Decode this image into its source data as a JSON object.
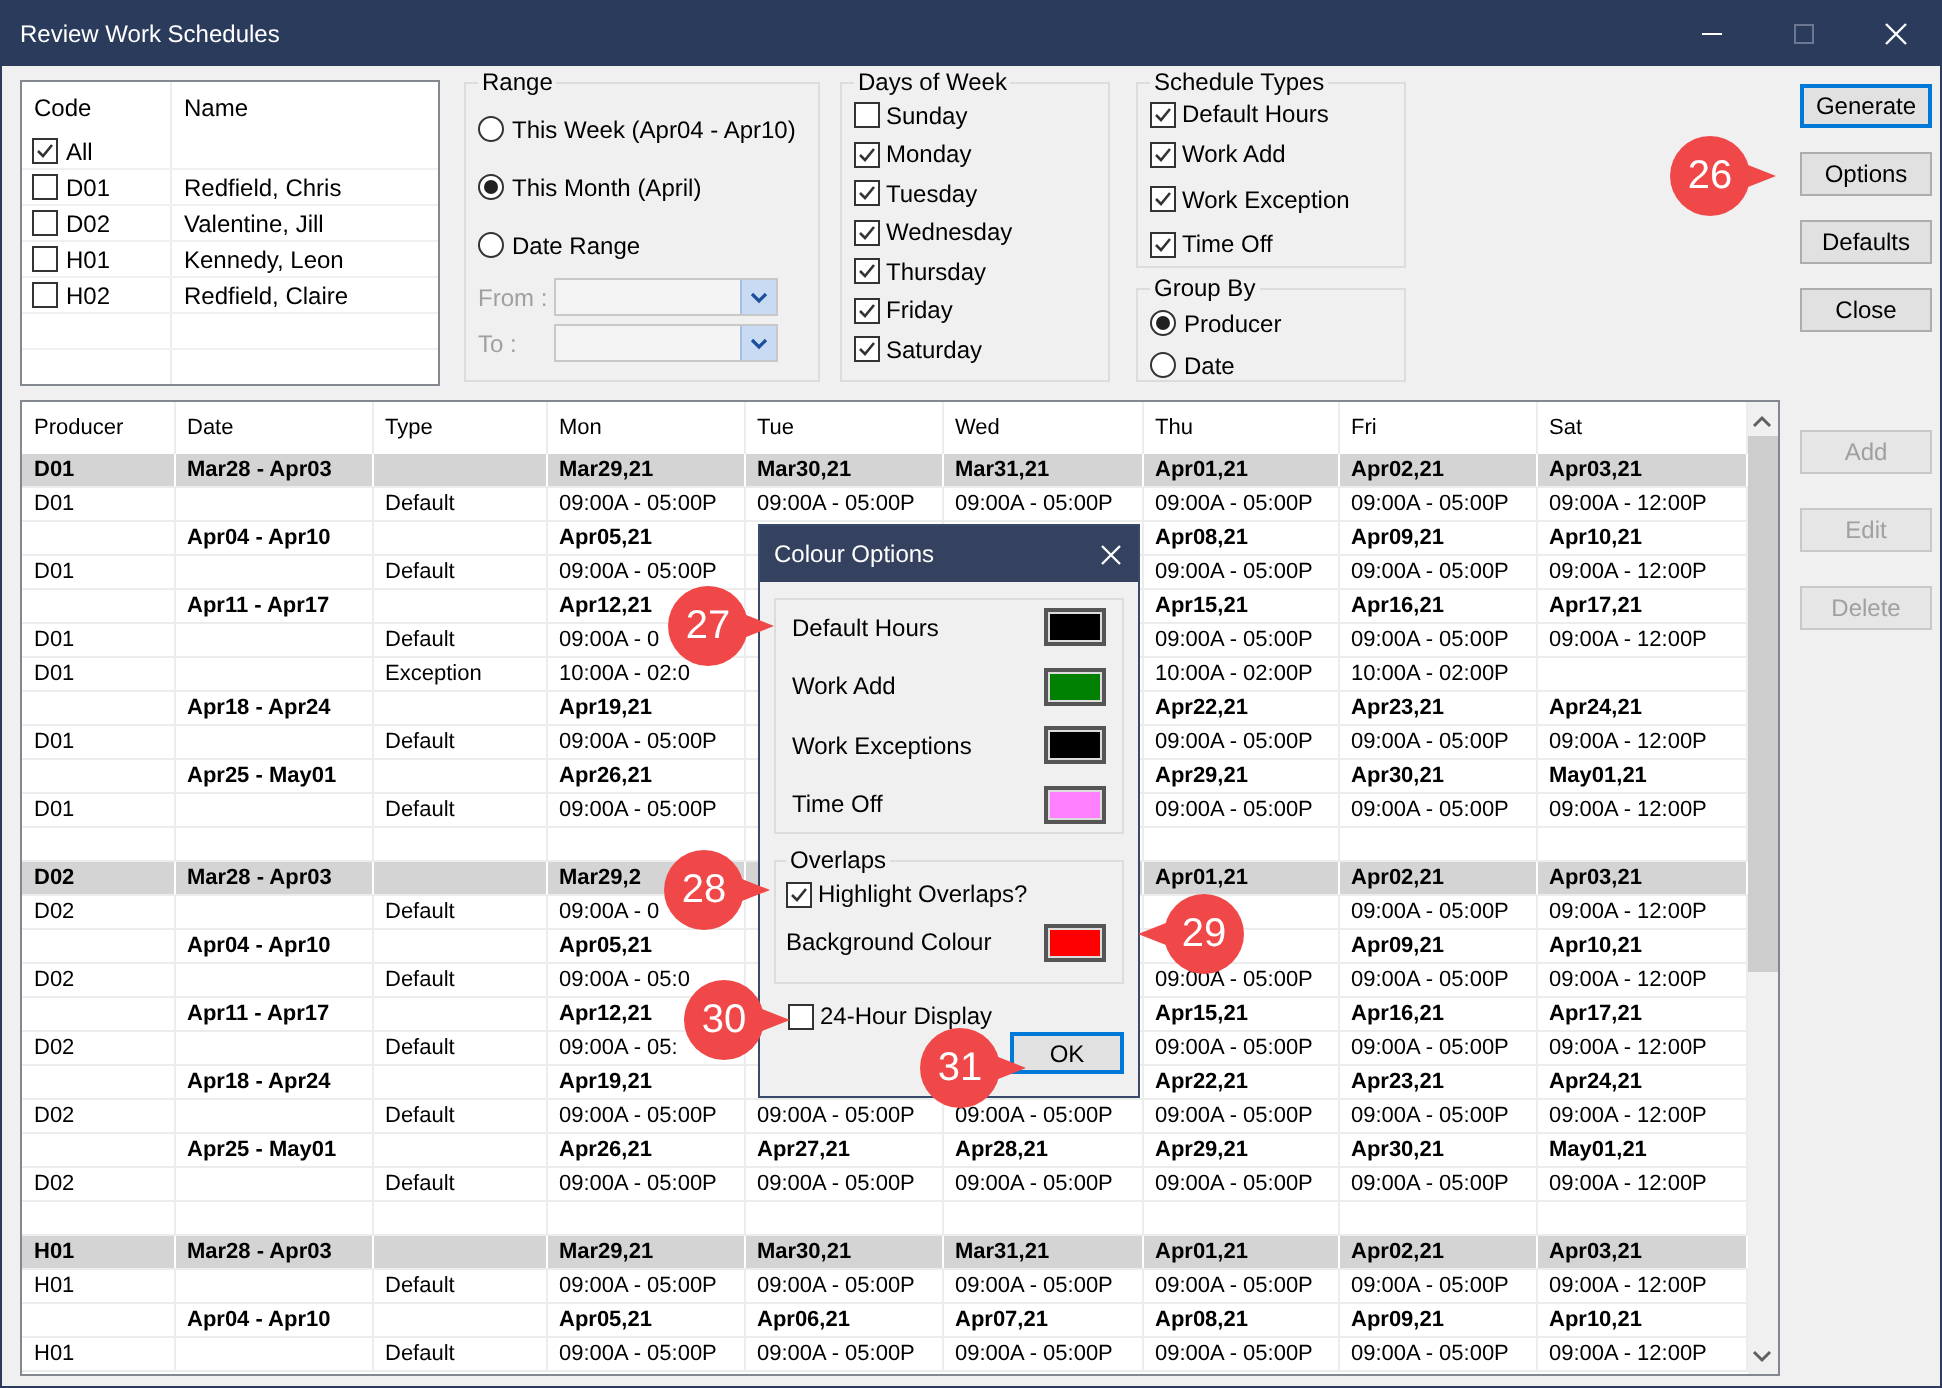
{
  "window": {
    "title": "Review Work Schedules"
  },
  "producer_list": {
    "columns": [
      "Code",
      "Name"
    ],
    "items": [
      {
        "code": "All",
        "checked": true
      },
      {
        "code": "D01",
        "name": "Redfield, Chris",
        "checked": false
      },
      {
        "code": "D02",
        "name": "Valentine, Jill",
        "checked": false
      },
      {
        "code": "H01",
        "name": "Kennedy, Leon",
        "checked": false
      },
      {
        "code": "H02",
        "name": "Redfield, Claire",
        "checked": false
      }
    ]
  },
  "range": {
    "title": "Range",
    "options": [
      {
        "label": "This Week (Apr04 - Apr10)",
        "selected": false
      },
      {
        "label": "This Month (April)",
        "selected": true
      },
      {
        "label": "Date Range",
        "selected": false
      }
    ],
    "from_label": "From :",
    "to_label": "To :",
    "disabled": true
  },
  "days_of_week": {
    "title": "Days of Week",
    "items": [
      {
        "label": "Sunday",
        "checked": false
      },
      {
        "label": "Monday",
        "checked": true
      },
      {
        "label": "Tuesday",
        "checked": true
      },
      {
        "label": "Wednesday",
        "checked": true
      },
      {
        "label": "Thursday",
        "checked": true
      },
      {
        "label": "Friday",
        "checked": true
      },
      {
        "label": "Saturday",
        "checked": true
      }
    ]
  },
  "schedule_types": {
    "title": "Schedule Types",
    "items": [
      {
        "label": "Default Hours",
        "checked": true
      },
      {
        "label": "Work Add",
        "checked": true
      },
      {
        "label": "Work Exception",
        "checked": true
      },
      {
        "label": "Time Off",
        "checked": true
      }
    ]
  },
  "group_by": {
    "title": "Group By",
    "options": [
      {
        "label": "Producer",
        "selected": true
      },
      {
        "label": "Date",
        "selected": false
      }
    ]
  },
  "buttons": [
    {
      "label": "Generate",
      "disabled": false,
      "focused": true
    },
    {
      "label": "Options",
      "disabled": false,
      "focused": false
    },
    {
      "label": "Defaults",
      "disabled": false,
      "focused": false
    },
    {
      "label": "Close",
      "disabled": false,
      "focused": false
    }
  ],
  "record_buttons": [
    {
      "label": "Add",
      "disabled": true
    },
    {
      "label": "Edit",
      "disabled": true
    },
    {
      "label": "Delete",
      "disabled": true
    }
  ],
  "table": {
    "columns": [
      "Producer",
      "Date",
      "Type",
      "Mon",
      "Tue",
      "Wed",
      "Thu",
      "Fri",
      "Sat"
    ],
    "rows": [
      {
        "kind": "group",
        "producer": "D01",
        "date": "Mar28 - Apr03",
        "mon": "Mar29,21",
        "tue": "Mar30,21",
        "wed": "Mar31,21",
        "thu": "Apr01,21",
        "fri": "Apr02,21",
        "sat": "Apr03,21"
      },
      {
        "kind": "data",
        "producer": "D01",
        "type": "Default",
        "mon": "09:00A - 05:00P",
        "tue": "09:00A - 05:00P",
        "wed": "09:00A - 05:00P",
        "thu": "09:00A - 05:00P",
        "fri": "09:00A - 05:00P",
        "sat": "09:00A - 12:00P"
      },
      {
        "kind": "week",
        "date": "Apr04 - Apr10",
        "mon": "Apr05,21",
        "thu": "Apr08,21",
        "fri": "Apr09,21",
        "sat": "Apr10,21"
      },
      {
        "kind": "data",
        "producer": "D01",
        "type": "Default",
        "mon": "09:00A - 05:00P",
        "thu": "09:00A - 05:00P",
        "fri": "09:00A - 05:00P",
        "sat": "09:00A - 12:00P"
      },
      {
        "kind": "week",
        "date": "Apr11 - Apr17",
        "mon": "Apr12,21",
        "thu": "Apr15,21",
        "fri": "Apr16,21",
        "sat": "Apr17,21"
      },
      {
        "kind": "data",
        "producer": "D01",
        "type": "Default",
        "mon": "09:00A - 0",
        "thu": "09:00A - 05:00P",
        "fri": "09:00A - 05:00P",
        "sat": "09:00A - 12:00P"
      },
      {
        "kind": "data",
        "producer": "D01",
        "type": "Exception",
        "mon": "10:00A - 02:0",
        "thu": "10:00A - 02:00P",
        "fri": "10:00A - 02:00P"
      },
      {
        "kind": "week",
        "date": "Apr18 - Apr24",
        "mon": "Apr19,21",
        "thu": "Apr22,21",
        "fri": "Apr23,21",
        "sat": "Apr24,21"
      },
      {
        "kind": "data",
        "producer": "D01",
        "type": "Default",
        "mon": "09:00A - 05:00P",
        "thu": "09:00A - 05:00P",
        "fri": "09:00A - 05:00P",
        "sat": "09:00A - 12:00P"
      },
      {
        "kind": "week",
        "date": "Apr25 - May01",
        "mon": "Apr26,21",
        "thu": "Apr29,21",
        "fri": "Apr30,21",
        "sat": "May01,21"
      },
      {
        "kind": "data",
        "producer": "D01",
        "type": "Default",
        "mon": "09:00A - 05:00P",
        "thu": "09:00A - 05:00P",
        "fri": "09:00A - 05:00P",
        "sat": "09:00A - 12:00P"
      },
      {
        "kind": "blank"
      },
      {
        "kind": "group",
        "producer": "D02",
        "date": "Mar28 - Apr03",
        "mon": "Mar29,2",
        "thu": "Apr01,21",
        "fri": "Apr02,21",
        "sat": "Apr03,21"
      },
      {
        "kind": "data",
        "producer": "D02",
        "type": "Default",
        "mon": "09:00A - 0",
        "fri": "09:00A - 05:00P",
        "sat": "09:00A - 12:00P"
      },
      {
        "kind": "week",
        "date": "Apr04 - Apr10",
        "mon": "Apr05,21",
        "fri": "Apr09,21",
        "sat": "Apr10,21"
      },
      {
        "kind": "data",
        "producer": "D02",
        "type": "Default",
        "mon": "09:00A - 05:0",
        "thu": "09:00A - 05:00P",
        "fri": "09:00A - 05:00P",
        "sat": "09:00A - 12:00P"
      },
      {
        "kind": "week",
        "date": "Apr11 - Apr17",
        "mon": "Apr12,21",
        "thu": "Apr15,21",
        "fri": "Apr16,21",
        "sat": "Apr17,21"
      },
      {
        "kind": "data",
        "producer": "D02",
        "type": "Default",
        "mon": "09:00A - 05:",
        "thu": "09:00A - 05:00P",
        "fri": "09:00A - 05:00P",
        "sat": "09:00A - 12:00P"
      },
      {
        "kind": "week",
        "date": "Apr18 - Apr24",
        "mon": "Apr19,21",
        "thu": "Apr22,21",
        "fri": "Apr23,21",
        "sat": "Apr24,21"
      },
      {
        "kind": "data",
        "producer": "D02",
        "type": "Default",
        "mon": "09:00A - 05:00P",
        "tue": "09:00A - 05:00P",
        "wed": "09:00A - 05:00P",
        "thu": "09:00A - 05:00P",
        "fri": "09:00A - 05:00P",
        "sat": "09:00A - 12:00P"
      },
      {
        "kind": "week",
        "date": "Apr25 - May01",
        "mon": "Apr26,21",
        "tue": "Apr27,21",
        "wed": "Apr28,21",
        "thu": "Apr29,21",
        "fri": "Apr30,21",
        "sat": "May01,21"
      },
      {
        "kind": "data",
        "producer": "D02",
        "type": "Default",
        "mon": "09:00A - 05:00P",
        "tue": "09:00A - 05:00P",
        "wed": "09:00A - 05:00P",
        "thu": "09:00A - 05:00P",
        "fri": "09:00A - 05:00P",
        "sat": "09:00A - 12:00P"
      },
      {
        "kind": "blank"
      },
      {
        "kind": "group",
        "producer": "H01",
        "date": "Mar28 - Apr03",
        "mon": "Mar29,21",
        "tue": "Mar30,21",
        "wed": "Mar31,21",
        "thu": "Apr01,21",
        "fri": "Apr02,21",
        "sat": "Apr03,21"
      },
      {
        "kind": "data",
        "producer": "H01",
        "type": "Default",
        "mon": "09:00A - 05:00P",
        "tue": "09:00A - 05:00P",
        "wed": "09:00A - 05:00P",
        "thu": "09:00A - 05:00P",
        "fri": "09:00A - 05:00P",
        "sat": "09:00A - 12:00P"
      },
      {
        "kind": "week",
        "date": "Apr04 - Apr10",
        "mon": "Apr05,21",
        "tue": "Apr06,21",
        "wed": "Apr07,21",
        "thu": "Apr08,21",
        "fri": "Apr09,21",
        "sat": "Apr10,21"
      },
      {
        "kind": "data",
        "producer": "H01",
        "type": "Default",
        "mon": "09:00A - 05:00P",
        "tue": "09:00A - 05:00P",
        "wed": "09:00A - 05:00P",
        "thu": "09:00A - 05:00P",
        "fri": "09:00A - 05:00P",
        "sat": "09:00A - 12:00P"
      }
    ]
  },
  "dialog": {
    "title": "Colour Options",
    "colours": [
      {
        "label": "Default Hours",
        "color": "#000000"
      },
      {
        "label": "Work Add",
        "color": "#008000"
      },
      {
        "label": "Work Exceptions",
        "color": "#000000"
      },
      {
        "label": "Time Off",
        "color": "#ff80ff"
      }
    ],
    "overlaps": {
      "title": "Overlaps",
      "highlight_label": "Highlight Overlaps?",
      "highlight": true,
      "background": {
        "label": "Background Colour",
        "color": "#ff0000"
      }
    },
    "hour24_label": "24-Hour Display",
    "hour24": false,
    "ok": "OK"
  },
  "callouts": [
    {
      "number": "26",
      "kind": "right"
    },
    {
      "number": "27",
      "kind": "right"
    },
    {
      "number": "28",
      "kind": "right"
    },
    {
      "number": "29",
      "kind": "left"
    },
    {
      "number": "30",
      "kind": "right"
    },
    {
      "number": "31",
      "kind": "right"
    }
  ]
}
